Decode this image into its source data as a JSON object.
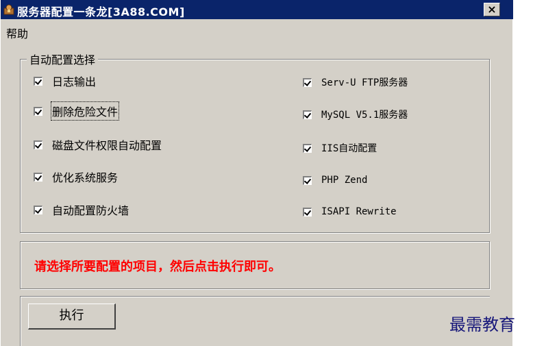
{
  "window": {
    "title": "服务器配置一条龙[3A88.COM]",
    "close_label": "×"
  },
  "menu": {
    "help_label": "帮助"
  },
  "auto_config": {
    "group_label": "自动配置选择",
    "left_options": [
      {
        "label": "日志输出",
        "checked": true
      },
      {
        "label": "删除危险文件",
        "checked": true
      },
      {
        "label": "磁盘文件权限自动配置",
        "checked": true
      },
      {
        "label": "优化系统服务",
        "checked": true
      },
      {
        "label": "自动配置防火墙",
        "checked": true
      }
    ],
    "right_options": [
      {
        "label": "Serv-U FTP服务器",
        "checked": true
      },
      {
        "label": "MySQL V5.1服务器",
        "checked": true
      },
      {
        "label": "IIS自动配置",
        "checked": true
      },
      {
        "label": "PHP Zend",
        "checked": true
      },
      {
        "label": "ISAPI Rewrite",
        "checked": true
      }
    ]
  },
  "message": {
    "text": "请选择所要配置的项目，然后点击执行即可。",
    "color": "#ff0000"
  },
  "actions": {
    "execute_label": "执行"
  },
  "watermark": {
    "text": "最需教育"
  },
  "colors": {
    "titlebar": "#0a246a",
    "window_bg": "#d4d0c8"
  }
}
